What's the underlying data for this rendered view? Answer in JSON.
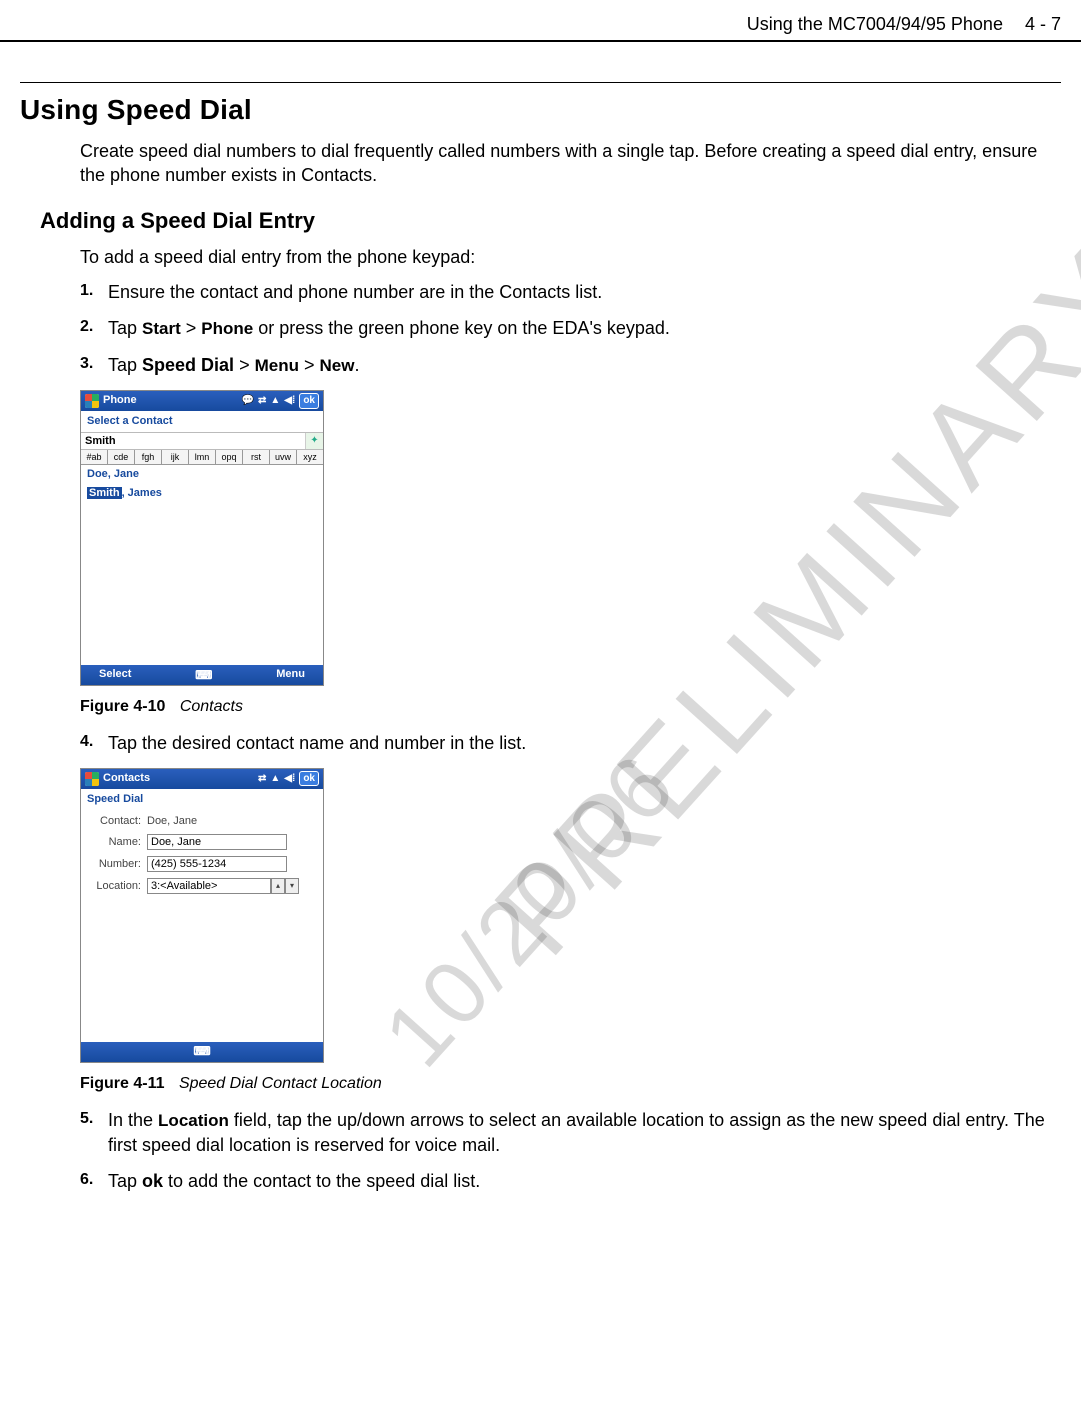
{
  "header": {
    "title": "Using the MC7004/94/95 Phone",
    "page": "4 - 7"
  },
  "watermark": {
    "line1": "PRELIMINARY",
    "line2": "10/20/06"
  },
  "section": {
    "title": "Using Speed Dial",
    "intro": "Create speed dial numbers to dial frequently called numbers with a single tap. Before creating a speed dial entry, ensure the phone number exists in Contacts."
  },
  "subsection": {
    "title": "Adding a Speed Dial Entry",
    "intro": "To add a speed dial entry from the phone keypad:"
  },
  "steps": {
    "s1": {
      "num": "1.",
      "text": "Ensure the contact and phone number are in the Contacts list."
    },
    "s2": {
      "num": "2.",
      "pre": "Tap ",
      "m1": "Start",
      "gt1": " > ",
      "m2": "Phone",
      "post": " or press the green phone key on the EDA's keypad."
    },
    "s3": {
      "num": "3.",
      "pre": "Tap ",
      "b1": "Speed Dial",
      "gt1": " > ",
      "m1": "Menu",
      "gt2": " > ",
      "m2": "New",
      "post": "."
    },
    "s4": {
      "num": "4.",
      "text": "Tap the desired contact name and number in the list."
    },
    "s5": {
      "num": "5.",
      "pre": "In the ",
      "m1": "Location",
      "post": " field, tap the up/down arrows to select an available location to assign as the new speed dial entry. The first speed dial location is reserved for voice mail."
    },
    "s6": {
      "num": "6.",
      "pre": "Tap ",
      "b1": "ok",
      "post": " to add the contact to the speed dial list."
    }
  },
  "fig1": {
    "num": "Figure 4-10",
    "title": "Contacts",
    "titlebar": "Phone",
    "ok": "ok",
    "subbar": "Select a Contact",
    "search": "Smith",
    "tabs": [
      "#ab",
      "cde",
      "fgh",
      "ijk",
      "lmn",
      "opq",
      "rst",
      "uvw",
      "xyz"
    ],
    "row1": "Doe, Jane",
    "row2_hl": "Smith",
    "row2_rest": ", James",
    "soft_left": "Select",
    "soft_right": "Menu"
  },
  "fig2": {
    "num": "Figure 4-11",
    "title": "Speed Dial Contact Location",
    "titlebar": "Contacts",
    "ok": "ok",
    "subbar": "Speed Dial",
    "contact_label": "Contact:",
    "contact_value": "Doe, Jane",
    "name_label": "Name:",
    "name_value": "Doe, Jane",
    "number_label": "Number:",
    "number_value": "(425) 555-1234",
    "location_label": "Location:",
    "location_value": "3:<Available>"
  }
}
